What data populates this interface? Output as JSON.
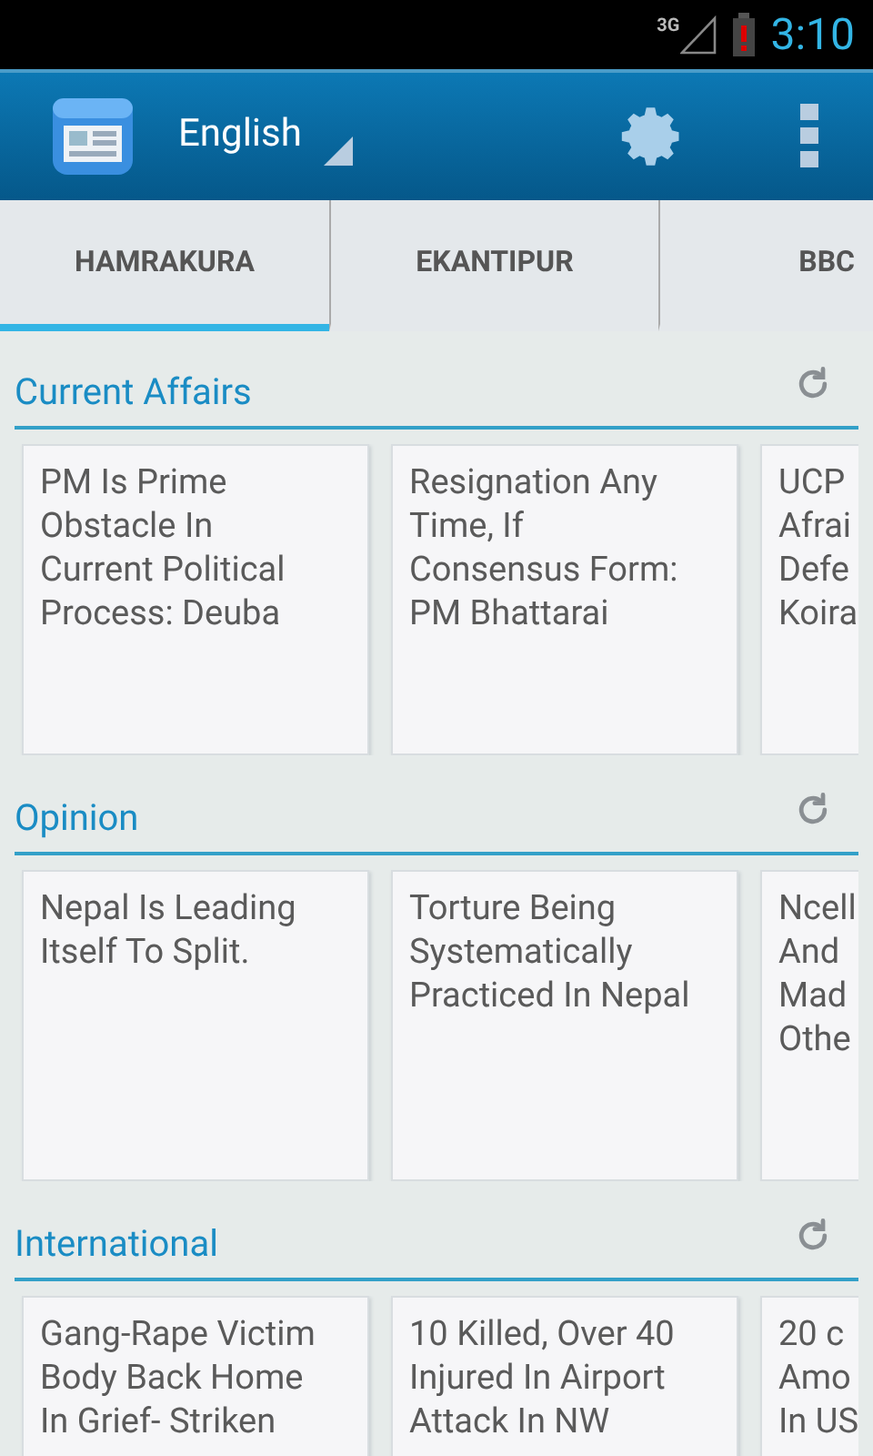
{
  "status_bar": {
    "network": "3G",
    "time": "3:10"
  },
  "app_bar": {
    "language": "English"
  },
  "tabs": [
    {
      "label": "HAMRAKURA",
      "selected": true
    },
    {
      "label": "EKANTIPUR",
      "selected": false
    },
    {
      "label": "BBC",
      "selected": false
    }
  ],
  "sections": [
    {
      "title": "Current Affairs",
      "cards": [
        {
          "lines": [
            "PM Is Prime",
            "Obstacle In",
            "Current Political",
            "Process: Deuba"
          ]
        },
        {
          "lines": [
            "Resignation Any",
            "Time, If",
            "Consensus Form:",
            "PM Bhattarai"
          ]
        },
        {
          "lines": [
            "UCP",
            "Afrai",
            "Defe",
            "Koira"
          ]
        }
      ]
    },
    {
      "title": "Opinion",
      "cards": [
        {
          "lines": [
            "Nepal Is Leading",
            "Itself To Split."
          ]
        },
        {
          "lines": [
            "Torture Being",
            "Systematically",
            "Practiced In Nepal"
          ]
        },
        {
          "lines": [
            "Ncell",
            "And",
            "Mad",
            "Othe"
          ]
        }
      ]
    },
    {
      "title": "International",
      "cards": [
        {
          "lines": [
            "Gang-Rape Victim",
            "Body Back Home",
            "In Grief- Striken"
          ]
        },
        {
          "lines": [
            "10 Killed, Over 40",
            "Injured In Airport",
            "Attack In NW"
          ]
        },
        {
          "lines": [
            "20 c",
            "Amo",
            "In US"
          ]
        }
      ]
    }
  ]
}
